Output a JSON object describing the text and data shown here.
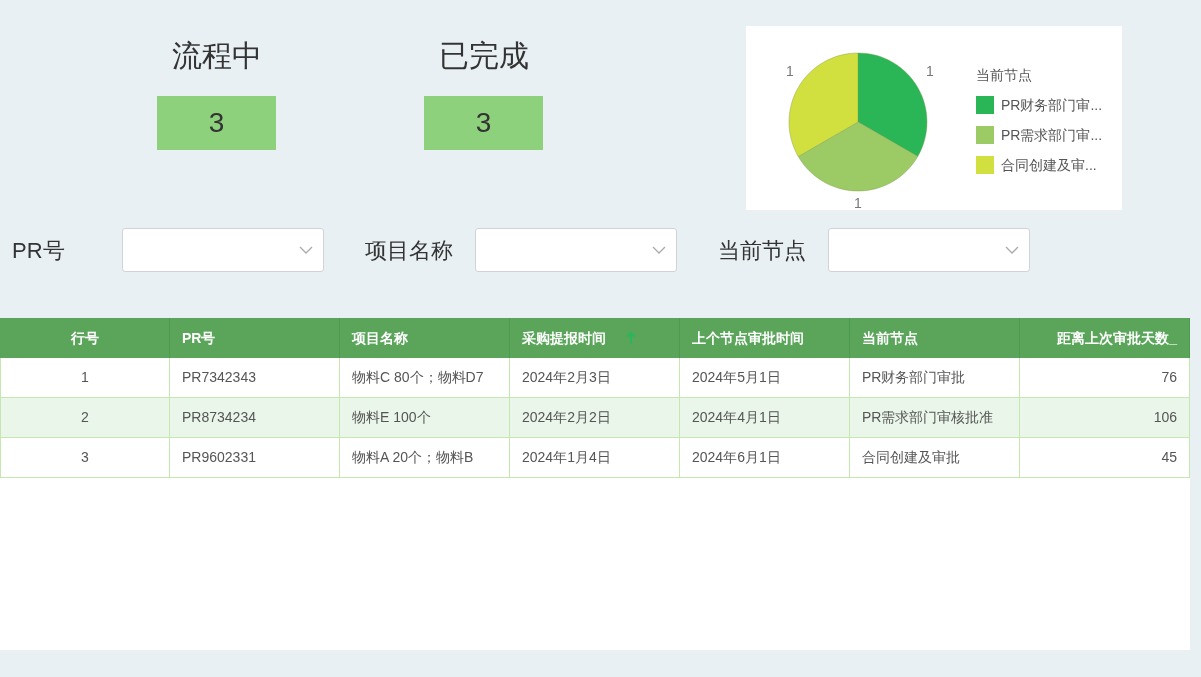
{
  "kpis": [
    {
      "title": "流程中",
      "value": "3"
    },
    {
      "title": "已完成",
      "value": "3"
    }
  ],
  "chart": {
    "chart_data": {
      "type": "pie",
      "legend": {
        "title": "当前节点"
      },
      "categories": [
        "PR财务部门审...",
        "PR需求部门审...",
        "合同创建及审..."
      ],
      "series": [
        {
          "values": [
            1,
            1,
            1
          ]
        }
      ],
      "colors": [
        "#2ab656",
        "#9ccb66",
        "#d1e03f"
      ],
      "data_labels": true
    }
  },
  "filters": [
    {
      "label": "PR号"
    },
    {
      "label": "项目名称"
    },
    {
      "label": "当前节点"
    }
  ],
  "table": {
    "columns": [
      {
        "label": "行号",
        "sorted": false
      },
      {
        "label": "PR号",
        "sorted": false
      },
      {
        "label": "项目名称",
        "sorted": false
      },
      {
        "label": "采购提报时间",
        "sorted": true
      },
      {
        "label": "上个节点审批时间",
        "sorted": false
      },
      {
        "label": "当前节点",
        "sorted": false
      },
      {
        "label": "距离上次审批天数_",
        "sorted": false
      }
    ],
    "rows": [
      [
        "1",
        "PR7342343",
        "物料C 80个；物料D7",
        "2024年2月3日",
        "2024年5月1日",
        "PR财务部门审批",
        "76"
      ],
      [
        "2",
        "PR8734234",
        "物料E 100个",
        "2024年2月2日",
        "2024年4月1日",
        "PR需求部门审核批准",
        "106"
      ],
      [
        "3",
        "PR9602331",
        "物料A  20个；物料B",
        "2024年1月4日",
        "2024年6月1日",
        "合同创建及审批",
        "45"
      ]
    ]
  }
}
